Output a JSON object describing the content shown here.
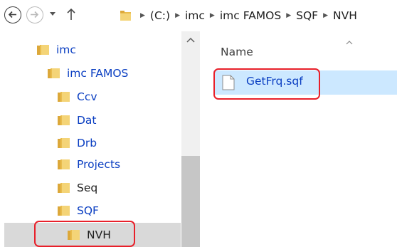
{
  "address_bar": {
    "back_icon": "back-arrow-icon",
    "forward_icon": "forward-arrow-icon",
    "recent_dropdown_icon": "chevron-down-icon",
    "up_icon": "up-arrow-icon",
    "path": [
      "(C:)",
      "imc",
      "imc FAMOS",
      "SQF",
      "NVH"
    ]
  },
  "nav_tree": {
    "items": [
      {
        "label": "imc"
      },
      {
        "label": "imc FAMOS"
      },
      {
        "label": "Ccv"
      },
      {
        "label": "Dat"
      },
      {
        "label": "Drb"
      },
      {
        "label": "Projects"
      },
      {
        "label": "Seq"
      },
      {
        "label": "SQF"
      },
      {
        "label": "NVH",
        "selected": true
      }
    ]
  },
  "file_list": {
    "column_header": "Name",
    "files": [
      {
        "name": "GetFrq.sqf",
        "icon": "document-icon",
        "selected": true
      }
    ]
  },
  "colors": {
    "link_blue": "#0b3fc2",
    "selection_blue": "#cce8ff",
    "nav_selection_gray": "#d9d9d9",
    "highlight_red": "#e8202a",
    "folder_yellow": "#e9bc4e"
  }
}
